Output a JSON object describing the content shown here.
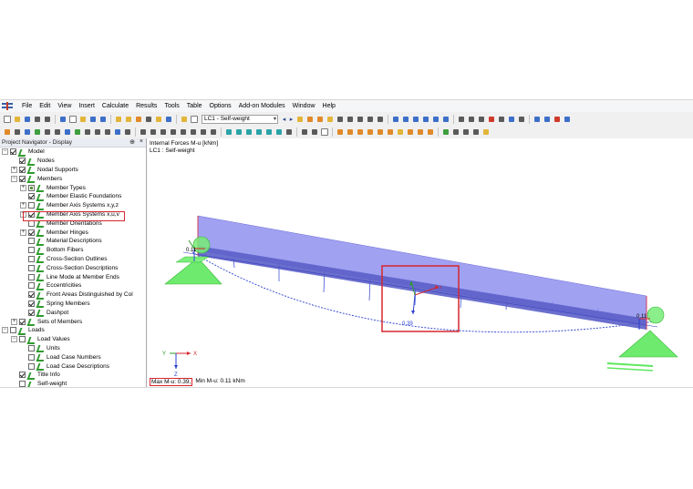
{
  "menu": {
    "items": [
      "File",
      "Edit",
      "View",
      "Insert",
      "Calculate",
      "Results",
      "Tools",
      "Table",
      "Options",
      "Add-on Modules",
      "Window",
      "Help"
    ]
  },
  "toolbar": {
    "load_case_combo": "LC1 - Self-weight"
  },
  "navigator": {
    "title": "Project Navigator - Display",
    "pin_icon": "pin-icon",
    "close_icon": "close-icon",
    "tree": [
      {
        "label": "Model",
        "level": 0,
        "expander": "−",
        "checked": "on",
        "icon": "model-icon"
      },
      {
        "label": "Nodes",
        "level": 1,
        "expander": "",
        "checked": "on",
        "icon": "check-icon"
      },
      {
        "label": "Nodal Supports",
        "level": 1,
        "expander": "+",
        "checked": "on",
        "icon": "check-icon"
      },
      {
        "label": "Members",
        "level": 1,
        "expander": "−",
        "checked": "on",
        "icon": "check-icon"
      },
      {
        "label": "Member Types",
        "level": 2,
        "expander": "+",
        "checked": "partial",
        "icon": "check-icon"
      },
      {
        "label": "Member Elastic Foundations",
        "level": 2,
        "expander": "",
        "checked": "on",
        "icon": "check-icon"
      },
      {
        "label": "Member Axis Systems x,y,z",
        "level": 2,
        "expander": "+",
        "checked": "off",
        "icon": "check-icon"
      },
      {
        "label": "Member Axis Systems x,u,v",
        "level": 2,
        "expander": "+",
        "checked": "on",
        "icon": "check-icon"
      },
      {
        "label": "Member Orientations",
        "level": 2,
        "expander": "",
        "checked": "off",
        "icon": "check-icon"
      },
      {
        "label": "Member Hinges",
        "level": 2,
        "expander": "+",
        "checked": "on",
        "icon": "check-icon"
      },
      {
        "label": "Material Descriptions",
        "level": 2,
        "expander": "",
        "checked": "off",
        "icon": "check-icon"
      },
      {
        "label": "Bottom Fibers",
        "level": 2,
        "expander": "",
        "checked": "off",
        "icon": "check-icon"
      },
      {
        "label": "Cross-Section Outlines",
        "level": 2,
        "expander": "",
        "checked": "off",
        "icon": "check-icon"
      },
      {
        "label": "Cross-Section Descriptions",
        "level": 2,
        "expander": "",
        "checked": "off",
        "icon": "check-icon"
      },
      {
        "label": "Line Mode at Member Ends",
        "level": 2,
        "expander": "",
        "checked": "off",
        "icon": "check-icon"
      },
      {
        "label": "Eccentricities",
        "level": 2,
        "expander": "",
        "checked": "off",
        "icon": "check-icon"
      },
      {
        "label": "Front Areas Distinguished by Col",
        "level": 2,
        "expander": "",
        "checked": "on",
        "icon": "check-icon"
      },
      {
        "label": "Spring Members",
        "level": 2,
        "expander": "",
        "checked": "on",
        "icon": "check-icon"
      },
      {
        "label": "Dashpot",
        "level": 2,
        "expander": "",
        "checked": "on",
        "icon": "check-icon"
      },
      {
        "label": "Sets of Members",
        "level": 1,
        "expander": "+",
        "checked": "on",
        "icon": "check-icon"
      },
      {
        "label": "Loads",
        "level": 0,
        "expander": "−",
        "checked": "off",
        "icon": "loads-icon"
      },
      {
        "label": "Load Values",
        "level": 1,
        "expander": "−",
        "checked": "off",
        "icon": "check-icon"
      },
      {
        "label": "Units",
        "level": 2,
        "expander": "",
        "checked": "off",
        "icon": "check-icon"
      },
      {
        "label": "Load Case Numbers",
        "level": 2,
        "expander": "",
        "checked": "off",
        "icon": "check-icon"
      },
      {
        "label": "Load Case Descriptions",
        "level": 2,
        "expander": "",
        "checked": "off",
        "icon": "check-icon"
      },
      {
        "label": "Title Info",
        "level": 1,
        "expander": "",
        "checked": "on",
        "icon": "check-icon"
      },
      {
        "label": "Self-weight",
        "level": 1,
        "expander": "",
        "checked": "off",
        "icon": "check-icon"
      }
    ]
  },
  "viewport": {
    "title_line1": "Internal Forces M-u [kNm]",
    "title_line2": "LC1 : Self-weight",
    "max_label": "Max M-u: 0.39,",
    "min_label": "Min M-u: 0.11 kNm",
    "value_midspan": "0.39",
    "value_left": "0.11",
    "value_right": "0.11",
    "axis_x": "X",
    "axis_y": "Y",
    "axis_z": "Z",
    "member_axis_u": "u",
    "member_axis_v": "v",
    "member_axis_x": "x",
    "colors": {
      "beam_fill": "#8f90ee",
      "beam_edge": "#d33a5a",
      "support": "#5ee85e",
      "diagram": "#2a3fd0",
      "highlight": "#d7262e"
    }
  }
}
